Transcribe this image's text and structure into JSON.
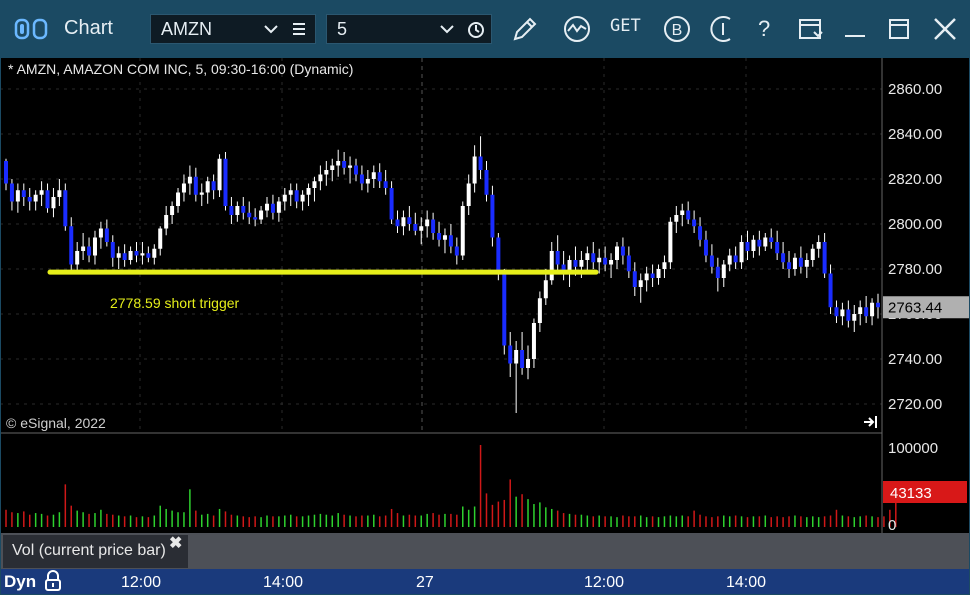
{
  "app": {
    "title": "Chart"
  },
  "toolbar": {
    "symbol": "AMZN",
    "interval": "5",
    "icons": [
      "draw-pencil-icon",
      "study-icon",
      "get-icon",
      "b-icon",
      "info-icon",
      "help-icon",
      "settings-icon",
      "minimize-icon",
      "maximize-icon",
      "close-icon"
    ],
    "get_label": "GET",
    "b_label": "B",
    "help_label": "?"
  },
  "chart_data": [
    {
      "type": "candlestick",
      "title": "* AMZN, AMAZON COM INC, 5, 09:30-16:00 (Dynamic)",
      "copyright": "© eSignal, 2022",
      "ylim": [
        2710,
        2870
      ],
      "y_ticks": [
        "2860.00",
        "2840.00",
        "2820.00",
        "2800.00",
        "2780.00",
        "2760.00",
        "2740.00",
        "2720.00"
      ],
      "last_price_label": "2763.44",
      "x_ticks": [
        "12:00",
        "14:00",
        "27",
        "12:00",
        "14:00"
      ],
      "colors": {
        "up": "#ffffff",
        "down": "#1a2cff",
        "trigger_line": "#e6ef1a",
        "background": "#000000",
        "grid": "#2a2a2a",
        "price_tag": "#b0b0b0"
      },
      "annotation": {
        "price": 2778.59,
        "text": "2778.59 short trigger"
      },
      "candles": [
        [
          2828,
          2829,
          2815,
          2818
        ],
        [
          2818,
          2820,
          2806,
          2810
        ],
        [
          2810,
          2818,
          2805,
          2815
        ],
        [
          2815,
          2818,
          2808,
          2812
        ],
        [
          2812,
          2816,
          2806,
          2810
        ],
        [
          2810,
          2815,
          2806,
          2813
        ],
        [
          2813,
          2819,
          2808,
          2815
        ],
        [
          2815,
          2818,
          2805,
          2807
        ],
        [
          2807,
          2816,
          2803,
          2812
        ],
        [
          2812,
          2820,
          2808,
          2815
        ],
        [
          2815,
          2818,
          2797,
          2799
        ],
        [
          2799,
          2803,
          2778,
          2782
        ],
        [
          2782,
          2792,
          2779,
          2788
        ],
        [
          2788,
          2796,
          2784,
          2790
        ],
        [
          2790,
          2794,
          2783,
          2786
        ],
        [
          2786,
          2797,
          2782,
          2794
        ],
        [
          2794,
          2801,
          2789,
          2798
        ],
        [
          2798,
          2802,
          2790,
          2792
        ],
        [
          2792,
          2795,
          2781,
          2785
        ],
        [
          2785,
          2790,
          2780,
          2787
        ],
        [
          2787,
          2791,
          2781,
          2784
        ],
        [
          2784,
          2790,
          2782,
          2788
        ],
        [
          2788,
          2792,
          2783,
          2786
        ],
        [
          2786,
          2792,
          2782,
          2787
        ],
        [
          2787,
          2790,
          2783,
          2785
        ],
        [
          2785,
          2791,
          2782,
          2789
        ],
        [
          2789,
          2799,
          2786,
          2798
        ],
        [
          2798,
          2808,
          2795,
          2804
        ],
        [
          2804,
          2810,
          2800,
          2808
        ],
        [
          2808,
          2816,
          2805,
          2814
        ],
        [
          2814,
          2822,
          2810,
          2818
        ],
        [
          2818,
          2826,
          2813,
          2821
        ],
        [
          2821,
          2825,
          2810,
          2813
        ],
        [
          2813,
          2818,
          2808,
          2814
        ],
        [
          2814,
          2821,
          2809,
          2819
        ],
        [
          2819,
          2822,
          2811,
          2815
        ],
        [
          2815,
          2831,
          2812,
          2829
        ],
        [
          2829,
          2832,
          2806,
          2808
        ],
        [
          2808,
          2812,
          2800,
          2804
        ],
        [
          2804,
          2810,
          2801,
          2808
        ],
        [
          2808,
          2812,
          2802,
          2805
        ],
        [
          2805,
          2810,
          2800,
          2803
        ],
        [
          2803,
          2807,
          2799,
          2802
        ],
        [
          2802,
          2808,
          2800,
          2806
        ],
        [
          2806,
          2812,
          2803,
          2809
        ],
        [
          2809,
          2813,
          2802,
          2805
        ],
        [
          2805,
          2812,
          2801,
          2810
        ],
        [
          2810,
          2816,
          2806,
          2813
        ],
        [
          2813,
          2818,
          2808,
          2815
        ],
        [
          2815,
          2818,
          2807,
          2810
        ],
        [
          2810,
          2815,
          2806,
          2813
        ],
        [
          2813,
          2818,
          2808,
          2816
        ],
        [
          2816,
          2821,
          2810,
          2819
        ],
        [
          2819,
          2826,
          2815,
          2822
        ],
        [
          2822,
          2828,
          2817,
          2824
        ],
        [
          2824,
          2829,
          2819,
          2826
        ],
        [
          2826,
          2833,
          2821,
          2828
        ],
        [
          2828,
          2832,
          2822,
          2825
        ],
        [
          2825,
          2830,
          2818,
          2826
        ],
        [
          2826,
          2829,
          2819,
          2822
        ],
        [
          2822,
          2826,
          2815,
          2818
        ],
        [
          2818,
          2824,
          2814,
          2820
        ],
        [
          2820,
          2826,
          2816,
          2823
        ],
        [
          2823,
          2827,
          2816,
          2819
        ],
        [
          2819,
          2824,
          2813,
          2816
        ],
        [
          2816,
          2819,
          2800,
          2802
        ],
        [
          2802,
          2806,
          2796,
          2799
        ],
        [
          2799,
          2806,
          2795,
          2803
        ],
        [
          2803,
          2808,
          2797,
          2800
        ],
        [
          2800,
          2805,
          2795,
          2797
        ],
        [
          2797,
          2803,
          2791,
          2799
        ],
        [
          2799,
          2806,
          2794,
          2802
        ],
        [
          2802,
          2805,
          2793,
          2796
        ],
        [
          2796,
          2801,
          2790,
          2793
        ],
        [
          2793,
          2798,
          2787,
          2795
        ],
        [
          2795,
          2800,
          2787,
          2790
        ],
        [
          2790,
          2794,
          2782,
          2786
        ],
        [
          2786,
          2810,
          2784,
          2808
        ],
        [
          2808,
          2822,
          2804,
          2818
        ],
        [
          2818,
          2835,
          2814,
          2830
        ],
        [
          2830,
          2839,
          2820,
          2824
        ],
        [
          2824,
          2828,
          2810,
          2813
        ],
        [
          2813,
          2817,
          2790,
          2794
        ],
        [
          2794,
          2796,
          2775,
          2778
        ],
        [
          2778,
          2780,
          2742,
          2746
        ],
        [
          2746,
          2752,
          2732,
          2738
        ],
        [
          2738,
          2748,
          2716,
          2744
        ],
        [
          2744,
          2752,
          2733,
          2736
        ],
        [
          2736,
          2746,
          2731,
          2740
        ],
        [
          2740,
          2758,
          2736,
          2756
        ],
        [
          2756,
          2770,
          2752,
          2767
        ],
        [
          2767,
          2780,
          2764,
          2775
        ],
        [
          2775,
          2792,
          2773,
          2788
        ],
        [
          2788,
          2795,
          2778,
          2782
        ],
        [
          2782,
          2788,
          2775,
          2779
        ],
        [
          2779,
          2786,
          2772,
          2784
        ],
        [
          2784,
          2790,
          2777,
          2781
        ],
        [
          2781,
          2788,
          2776,
          2784
        ],
        [
          2784,
          2790,
          2779,
          2787
        ],
        [
          2787,
          2792,
          2780,
          2783
        ],
        [
          2783,
          2789,
          2778,
          2785
        ],
        [
          2785,
          2790,
          2779,
          2782
        ],
        [
          2782,
          2787,
          2776,
          2784
        ],
        [
          2784,
          2792,
          2780,
          2790
        ],
        [
          2790,
          2794,
          2782,
          2786
        ],
        [
          2786,
          2790,
          2776,
          2779
        ],
        [
          2779,
          2783,
          2768,
          2772
        ],
        [
          2772,
          2778,
          2765,
          2775
        ],
        [
          2775,
          2781,
          2770,
          2778
        ],
        [
          2778,
          2782,
          2772,
          2776
        ],
        [
          2776,
          2782,
          2773,
          2780
        ],
        [
          2780,
          2786,
          2776,
          2783
        ],
        [
          2783,
          2803,
          2780,
          2801
        ],
        [
          2801,
          2808,
          2796,
          2804
        ],
        [
          2804,
          2809,
          2799,
          2806
        ],
        [
          2806,
          2810,
          2800,
          2802
        ],
        [
          2802,
          2806,
          2796,
          2799
        ],
        [
          2799,
          2803,
          2790,
          2793
        ],
        [
          2793,
          2797,
          2783,
          2786
        ],
        [
          2786,
          2791,
          2778,
          2781
        ],
        [
          2781,
          2785,
          2770,
          2776
        ],
        [
          2776,
          2784,
          2772,
          2782
        ],
        [
          2782,
          2789,
          2779,
          2786
        ],
        [
          2786,
          2790,
          2780,
          2783
        ],
        [
          2783,
          2795,
          2780,
          2792
        ],
        [
          2792,
          2797,
          2784,
          2788
        ],
        [
          2788,
          2795,
          2785,
          2793
        ],
        [
          2793,
          2797,
          2786,
          2790
        ],
        [
          2790,
          2796,
          2788,
          2794
        ],
        [
          2794,
          2798,
          2789,
          2792
        ],
        [
          2792,
          2797,
          2784,
          2787
        ],
        [
          2787,
          2792,
          2780,
          2783
        ],
        [
          2783,
          2788,
          2776,
          2780
        ],
        [
          2780,
          2787,
          2777,
          2785
        ],
        [
          2785,
          2790,
          2778,
          2781
        ],
        [
          2781,
          2787,
          2776,
          2784
        ],
        [
          2784,
          2791,
          2781,
          2789
        ],
        [
          2789,
          2795,
          2785,
          2792
        ],
        [
          2792,
          2796,
          2776,
          2778
        ],
        [
          2778,
          2782,
          2760,
          2763
        ],
        [
          2763,
          2766,
          2756,
          2759
        ],
        [
          2759,
          2765,
          2755,
          2762
        ],
        [
          2762,
          2766,
          2754,
          2757
        ],
        [
          2757,
          2764,
          2752,
          2760
        ],
        [
          2760,
          2766,
          2755,
          2763
        ],
        [
          2763,
          2768,
          2756,
          2759
        ],
        [
          2759,
          2767,
          2755,
          2765
        ],
        [
          2765,
          2769,
          2758,
          2763
        ]
      ],
      "volume": {
        "ylim": [
          0,
          100000
        ],
        "y_ticks": [
          "100000",
          "0"
        ],
        "last_label": "43133",
        "label": "Vol (current price bar)",
        "colors": {
          "up": "#2ed12e",
          "down": "#d01818",
          "last_tag": "#d81818"
        },
        "values": [
          21000,
          18000,
          17000,
          19000,
          15000,
          17000,
          16000,
          14000,
          15000,
          18000,
          52000,
          26000,
          20000,
          18000,
          16000,
          17000,
          21000,
          16000,
          15000,
          14000,
          13000,
          14000,
          12000,
          13000,
          12000,
          14000,
          26000,
          22000,
          20000,
          18000,
          18000,
          46000,
          20000,
          15000,
          16000,
          14000,
          22000,
          19000,
          15000,
          14000,
          13000,
          12000,
          13000,
          12000,
          14000,
          13000,
          13000,
          14000,
          15000,
          13000,
          13000,
          14000,
          15000,
          16000,
          15000,
          14000,
          17000,
          15000,
          14000,
          13000,
          14000,
          14000,
          15000,
          13000,
          14000,
          22000,
          17000,
          14000,
          15000,
          14000,
          14000,
          16000,
          17000,
          15000,
          16000,
          16000,
          15000,
          25000,
          21000,
          25000,
          100000,
          41000,
          27000,
          31000,
          33000,
          58000,
          37000,
          40000,
          34000,
          28000,
          30000,
          24000,
          22000,
          20000,
          17000,
          16000,
          15000,
          15000,
          14000,
          13000,
          14000,
          13000,
          13000,
          12000,
          14000,
          13000,
          13000,
          14000,
          12000,
          13000,
          12000,
          13000,
          14000,
          13000,
          14000,
          13000,
          20000,
          15000,
          13000,
          12000,
          13000,
          14000,
          13000,
          14000,
          13000,
          12000,
          13000,
          13000,
          14000,
          12000,
          13000,
          12000,
          13000,
          14000,
          13000,
          12000,
          13000,
          12000,
          13000,
          14000,
          21000,
          14000,
          13000,
          12000,
          13000,
          14000,
          13000,
          12000,
          13000,
          21000,
          43133
        ]
      }
    }
  ],
  "footer": {
    "dyn_label": "Dyn"
  }
}
